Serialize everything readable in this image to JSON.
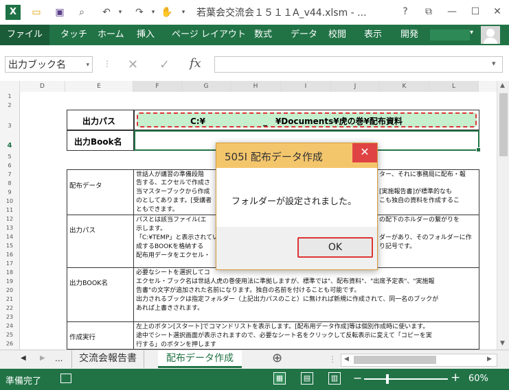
{
  "window": {
    "title": "若葉会交流会１５１１A_v44.xlsm - ...",
    "help": "?",
    "minimize": "—",
    "maximize": "☐",
    "close": "✕"
  },
  "ribbon": {
    "tabs": [
      "ファイル",
      "タッチ",
      "ホーム",
      "挿入",
      "ページ レイアウト",
      "数式",
      "データ",
      "校閲",
      "表示",
      "開発"
    ]
  },
  "formula_bar": {
    "name_box": "出力ブック名",
    "cancel": "✕",
    "enter": "✓",
    "fx": "fx",
    "value": ""
  },
  "columns": [
    "D",
    "E",
    "F",
    "G",
    "H",
    "I",
    "J",
    "K",
    "L"
  ],
  "rows": [
    "1",
    "2",
    "3",
    "4",
    "5",
    "6",
    "7",
    "8",
    "9",
    "10",
    "11",
    "12",
    "13",
    "14",
    "15",
    "16",
    "17",
    "18",
    "19",
    "20",
    "21",
    "22",
    "23",
    "24",
    "25",
    "26"
  ],
  "sheet": {
    "output_path_label": "出力パス",
    "output_path_value": "C:¥　　　　　　　_　¥Documents¥虎の巻¥配布資料",
    "output_book_label": "出力Book名",
    "output_book_value": "",
    "sections": [
      {
        "label": "配布データ",
        "lines": [
          "世話人が講習の準備段階",
          "告する、エクセルで作成さ",
          "当マスターブックから作成",
          "のとしてあります。[受講者",
          "ともできます。"
        ],
        "lines_right": [
          "ター、それに事務局に配布・報",
          "",
          "[実施報告書]が標準的なも",
          "こも独自の資料を作成するこ",
          ""
        ]
      },
      {
        "label": "出力パス",
        "lines": [
          "パスとは該当ファイル(エ",
          "示します。",
          "「C:¥TEMP」と表示されてい",
          "成するBOOKを格納する",
          "配布用データをエクセル・"
        ],
        "lines_right": [
          "の配下のホルダーの繋がりを",
          "",
          "ダーがあり、そのフォルダーに作",
          "り記号です。",
          ""
        ]
      },
      {
        "label": "出力BOOK名",
        "lines": [
          "必要なシートを選択してコ",
          "エクセル・ブック名は世話人虎の巻使用法に準拠しますが、標準では\"、配布資料\"、\"出席予定表\"、\"実施報",
          "告書\"の文字が追加された名前になります。独自の名前を付けることも可能です。",
          "出力されるブックは指定フォルダー（上記出力パスのこと）に無ければ新規に作成されて、同一名のブックが",
          "あれば上書きされます。"
        ],
        "lines_right": [
          "",
          "",
          "",
          "",
          ""
        ]
      },
      {
        "label": "作成実行",
        "lines": [
          "左上のボタン[スタート]でコマンドリストを表示します。[配布用データ作成]等は個別作成時に使います。",
          "途中でシート選択画面が表示されますので、必要なシート名をクリックして反転表示に変えて「コピーを実",
          "行する」のボタンを押します"
        ],
        "lines_right": [
          "",
          "",
          ""
        ]
      }
    ]
  },
  "sheet_tabs": {
    "prev": "◀",
    "next": "▶",
    "more": "...",
    "tabs": [
      "交流会報告書",
      "配布データ作成"
    ],
    "active": "配布データ作成",
    "add": "⊕"
  },
  "status_bar": {
    "ready": "準備完了",
    "zoom_out": "−",
    "zoom_in": "+",
    "zoom": "60%"
  },
  "dialog": {
    "title": "505I 配布データ作成",
    "close": "✕",
    "message": "フォルダーが設定されました。",
    "ok": "OK"
  },
  "colors": {
    "excel_green": "#217346",
    "path_fill": "#c6efce",
    "dialog_header": "#f4c66c",
    "dialog_close": "#e04343"
  }
}
